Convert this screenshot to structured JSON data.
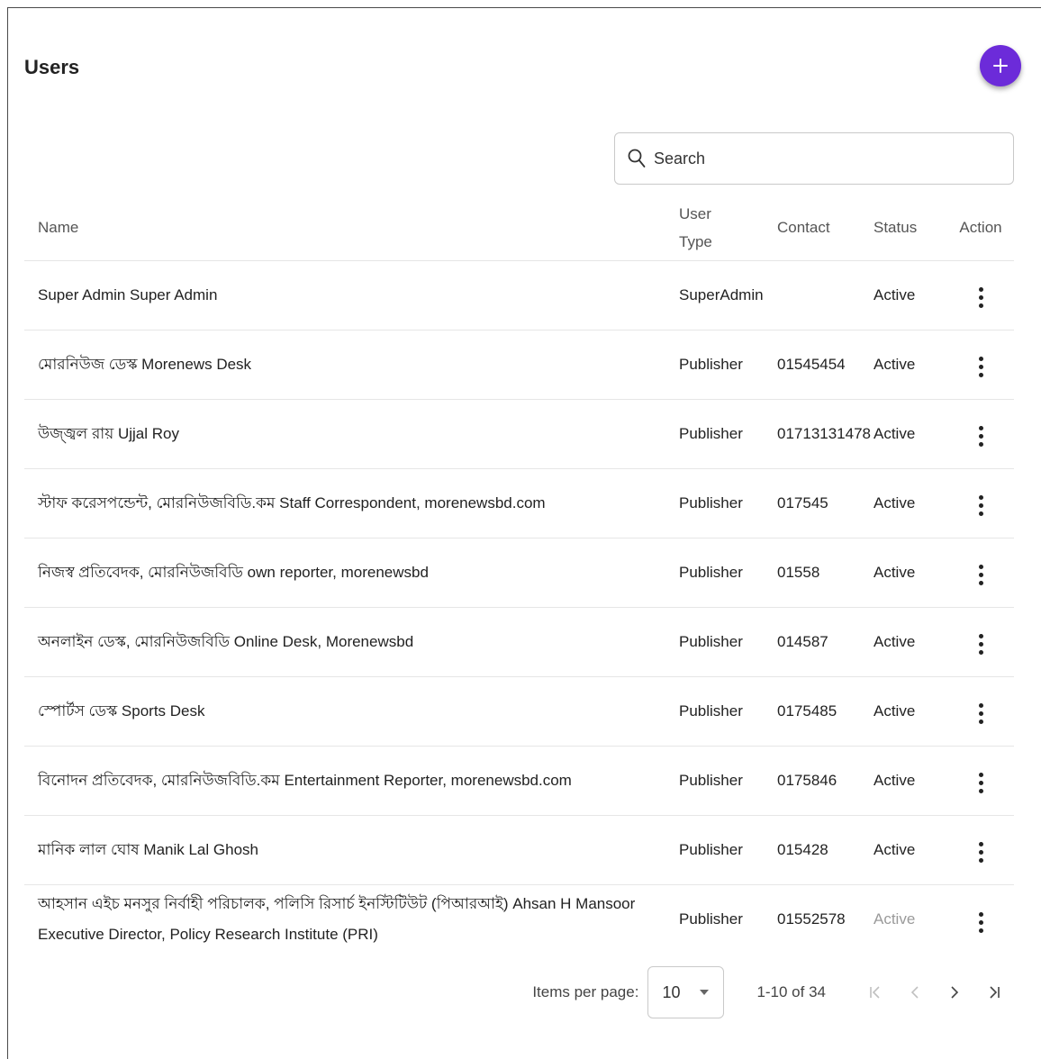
{
  "page": {
    "title": "Users"
  },
  "add_button": {
    "label": "+"
  },
  "search": {
    "placeholder": "Search"
  },
  "table": {
    "headers": {
      "name": "Name",
      "user_type": "User Type",
      "contact": "Contact",
      "status": "Status",
      "action": "Action"
    },
    "rows": [
      {
        "name": "Super Admin Super Admin",
        "user_type": "SuperAdmin",
        "contact": "",
        "status": "Active"
      },
      {
        "name": "মোরনিউজ ডেস্ক Morenews Desk",
        "user_type": "Publisher",
        "contact": "01545454",
        "status": "Active"
      },
      {
        "name": "উজ্জ্বল রায় Ujjal Roy",
        "user_type": "Publisher",
        "contact": "01713131478",
        "status": "Active"
      },
      {
        "name": "স্টাফ করেসপন্ডেন্ট, মোরনিউজবিডি.কম Staff Correspondent, morenewsbd.com",
        "user_type": "Publisher",
        "contact": "017545",
        "status": "Active"
      },
      {
        "name": "নিজস্ব প্রতিবেদক, মোরনিউজবিডি own reporter, morenewsbd",
        "user_type": "Publisher",
        "contact": "01558",
        "status": "Active"
      },
      {
        "name": "অনলাইন ডেস্ক, মোরনিউজবিডি Online Desk, Morenewsbd",
        "user_type": "Publisher",
        "contact": "014587",
        "status": "Active"
      },
      {
        "name": "স্পোর্টস ডেস্ক Sports Desk",
        "user_type": "Publisher",
        "contact": "0175485",
        "status": "Active"
      },
      {
        "name": "বিনোদন প্রতিবেদক, মোরনিউজবিডি.কম Entertainment Reporter, morenewsbd.com",
        "user_type": "Publisher",
        "contact": "0175846",
        "status": "Active"
      },
      {
        "name": "মানিক লাল ঘোষ Manik Lal Ghosh",
        "user_type": "Publisher",
        "contact": "015428",
        "status": "Active"
      },
      {
        "name": "আহসান এইচ মনসুর নির্বাহী পরিচালক, পলিসি রিসার্চ ইনস্টিটিউট (পিআরআই) Ahsan H Mansoor Executive Director, Policy Research Institute (PRI)",
        "user_type": "Publisher",
        "contact": "01552578",
        "status": "Active"
      }
    ]
  },
  "paginator": {
    "items_per_page_label": "Items per page:",
    "items_per_page_value": "10",
    "range_label": "1-10 of 34"
  },
  "colors": {
    "accent": "#6c2bd9",
    "border": "#c9c9c9",
    "row_divider": "#e6e6e6"
  },
  "icons": {
    "add": "plus-icon",
    "search": "search-icon",
    "action": "kebab-menu-icon",
    "first": "first-page-icon",
    "prev": "chevron-left-icon",
    "next": "chevron-right-icon",
    "last": "last-page-icon"
  }
}
